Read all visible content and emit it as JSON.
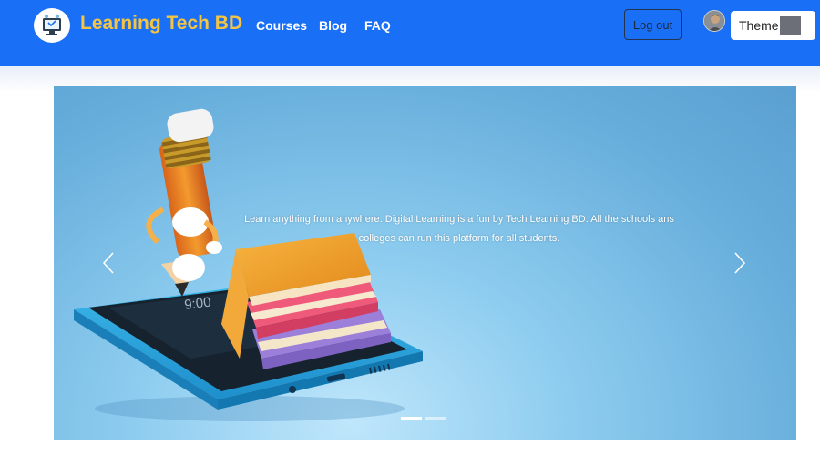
{
  "navbar": {
    "brand": "Learning Tech BD",
    "links": [
      "Courses",
      "Blog",
      "FAQ"
    ],
    "logout_label": "Log out",
    "theme_label": "Theme",
    "colors": {
      "bar": "#1a6ff7",
      "brand_text": "#f4c542"
    }
  },
  "carousel": {
    "caption": "Learn anything from anywhere. Digital Learning is a fun by Tech Learning BD. All the schools ans colleges can run this platform for all students.",
    "phone_clock": "9:00",
    "slide_count": 2,
    "active_slide": 1,
    "icons": {
      "prev": "chevron-left-icon",
      "next": "chevron-right-icon"
    }
  }
}
